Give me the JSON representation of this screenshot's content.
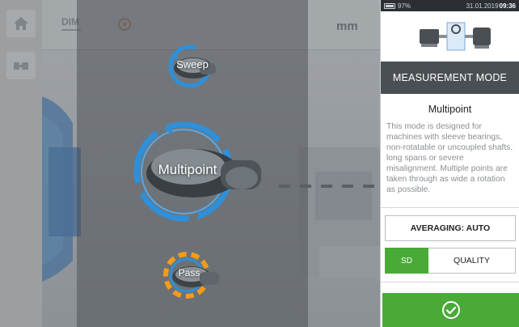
{
  "topbar": {
    "dim_label": "DIM",
    "unit": "mm"
  },
  "toolbar": {
    "home_icon": "home-icon",
    "machines_icon": "machine-icon"
  },
  "modes": {
    "sweep_label": "Sweep",
    "multipoint_label": "Multipoint",
    "pass_label": "Pass"
  },
  "status": {
    "battery": "97%",
    "date": "31.01.2019",
    "time": "09:36"
  },
  "panel": {
    "header": "MEASUREMENT MODE",
    "mode_title": "Multipoint",
    "mode_description": "This mode is designed for machines with sleeve bearings, non-rotatable or uncoupled shafts, long spans or severe misalignment. Multiple points are taken through as wide a rotation as possible.",
    "averaging_label": "AVERAGING: AUTO",
    "toggle_sd": "SD",
    "toggle_quality": "QUALITY",
    "confirm_icon": "check-circle-icon"
  },
  "colors": {
    "accent_green": "#4aaa38",
    "ring_blue": "#2f8fd8",
    "ring_orange": "#f39c1a",
    "header_dark": "#4a4f53"
  }
}
